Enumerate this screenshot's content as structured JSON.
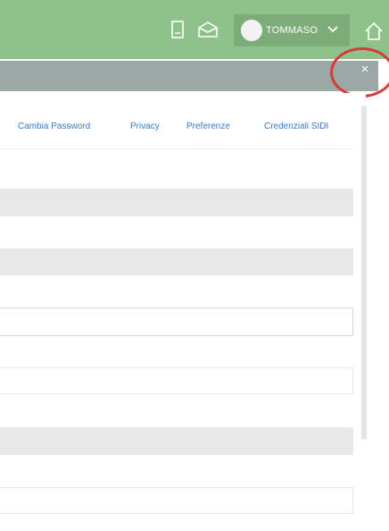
{
  "header": {
    "user_name": "TOMMASO",
    "icons": [
      "document-icon",
      "mail-icon",
      "user-avatar",
      "chevron-down-icon",
      "home-icon"
    ]
  },
  "modal": {
    "close_label": "×"
  },
  "tabs": [
    {
      "label": "Cambia Password"
    },
    {
      "label": "Privacy"
    },
    {
      "label": "Preferenze"
    },
    {
      "label": "Credenziali SIDI"
    }
  ],
  "colors": {
    "header_bg": "#8fc28b",
    "modal_header_bg": "#9aa8a6",
    "tab_link": "#3b79c9",
    "annotation": "#d83a37"
  }
}
